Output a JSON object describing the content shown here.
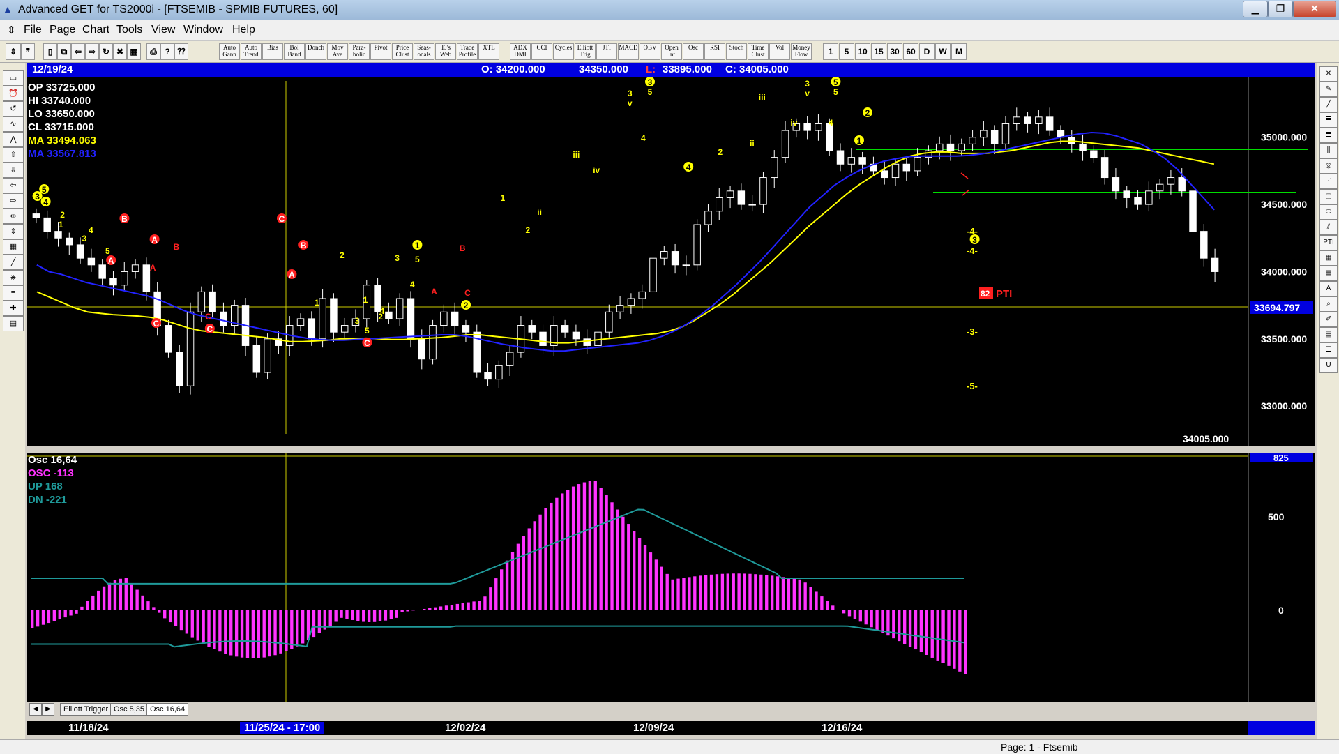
{
  "window": {
    "title": "Advanced GET for TS2000i - [FTSEMIB - SPMIB FUTURES, 60]",
    "buttons": {
      "minimize": "▁",
      "maximize": "❐",
      "close": "✕"
    }
  },
  "menu": [
    "File",
    "Page",
    "Chart",
    "Tools",
    "View",
    "Window",
    "Help"
  ],
  "toolbar": {
    "studies": [
      "Auto Gann",
      "Auto Trend",
      "Bias",
      "Bol Band",
      "Donch",
      "Mov Ave",
      "Para-bolic",
      "Pivot",
      "Price Clust",
      "Seas-onals",
      "TJ's Web",
      "Trade Profile",
      "XTL",
      "ADX DMI",
      "CCI",
      "Cycles",
      "Elliott Trig",
      "JTI",
      "MACD",
      "OBV",
      "Open Int",
      "Osc",
      "RSI",
      "Stoch",
      "Time Clust",
      "Vol",
      "Money Flow"
    ],
    "intervals": [
      "1",
      "5",
      "10",
      "15",
      "30",
      "60",
      "D",
      "W",
      "M"
    ]
  },
  "infobar": {
    "date": "12/19/24",
    "open": "O: 34200.000",
    "high": "34350.000",
    "low_label": "L:",
    "low_value": "33895.000",
    "close": "C: 34005.000"
  },
  "legend": {
    "op": "OP  33725.000",
    "hi": "HI   33740.000",
    "lo": "LO  33650.000",
    "cl": "CL  33715.000",
    "ma1": "MA 33494.063",
    "ma2": "MA 33567.813"
  },
  "price_axis": {
    "labels": [
      "35000.000",
      "34500.000",
      "34000.000",
      "33500.000",
      "33000.000"
    ],
    "current": "33694.797",
    "last": "34005.000"
  },
  "pti": {
    "value": "82",
    "label": "PTI"
  },
  "proj_labels": [
    "-4-",
    "-4-",
    "-3-",
    "-5-"
  ],
  "osc_legend": {
    "title": "Osc 16,64",
    "osc": "OSC -113",
    "up": "UP   168",
    "dn": "DN   -221"
  },
  "osc_axis": {
    "top": "825",
    "labels": [
      "500",
      "0"
    ]
  },
  "tabs": [
    "Elliott Trigger",
    "Osc 5,35",
    "Osc 16,64"
  ],
  "dates": {
    "labels": [
      "11/18/24",
      "12/02/24",
      "12/09/24",
      "12/16/24"
    ],
    "cursor": "11/25/24 - 17:00"
  },
  "status": "Page: 1 - Ftsemib",
  "colors": {
    "bg": "#000000",
    "candles": "#ffffff",
    "ma_yellow": "#ffff00",
    "ma_blue": "#2222ff",
    "osc_bar": "#ff33ff",
    "band": "#1f9a9a",
    "target": "#00dd00",
    "wave_red": "#ff2020",
    "info_blue": "#0000e0"
  },
  "chart_data": {
    "type": "candlestick",
    "ylim": [
      32700,
      35450
    ],
    "close": [
      34400,
      34300,
      34250,
      34200,
      34100,
      34050,
      33950,
      33900,
      34000,
      34050,
      33850,
      33600,
      33400,
      33150,
      33700,
      33850,
      33700,
      33600,
      33750,
      33450,
      33250,
      33500,
      33450,
      33600,
      33650,
      33500,
      33800,
      33550,
      33600,
      33650,
      33900,
      33700,
      33650,
      33800,
      33500,
      33350,
      33600,
      33700,
      33600,
      33550,
      33250,
      33200,
      33300,
      33400,
      33600,
      33550,
      33450,
      33600,
      33550,
      33500,
      33450,
      33550,
      33700,
      33750,
      33800,
      33850,
      34100,
      34150,
      34050,
      34050,
      34350,
      34450,
      34550,
      34600,
      34500,
      34500,
      34700,
      34850,
      35050,
      35100,
      35050,
      35100,
      34900,
      34800,
      34850,
      34800,
      34750,
      34700,
      34800,
      34750,
      34850,
      34900,
      34950,
      34900,
      34950,
      35000,
      35050,
      34950,
      35100,
      35150,
      35100,
      35150,
      35050,
      35000,
      34950,
      34900,
      34850,
      34700,
      34600,
      34550,
      34500,
      34600,
      34650,
      34700,
      34600,
      34300,
      34100,
      34000
    ],
    "ma_yellow": [
      33850,
      33810,
      33770,
      33730,
      33700,
      33690,
      33680,
      33675,
      33670,
      33660,
      33640,
      33610,
      33580,
      33560,
      33550,
      33540,
      33530,
      33520,
      33510,
      33495,
      33480,
      33480,
      33485,
      33490,
      33500,
      33500,
      33505,
      33500,
      33495,
      33495,
      33500,
      33505,
      33510,
      33520,
      33530,
      33530,
      33520,
      33510,
      33500,
      33490,
      33480,
      33470,
      33470,
      33480,
      33490,
      33500,
      33510,
      33520,
      33530,
      33540,
      33560,
      33590,
      33640,
      33700,
      33760,
      33830,
      33910,
      33990,
      34070,
      34160,
      34250,
      34340,
      34420,
      34500,
      34580,
      34650,
      34710,
      34770,
      34820,
      34860,
      34880,
      34890,
      34890,
      34880,
      34880,
      34880,
      34890,
      34900,
      34920,
      34940,
      34960,
      34970,
      34970,
      34960,
      34950,
      34940,
      34930,
      34920,
      34900,
      34880,
      34860,
      34840,
      34820,
      34800
    ],
    "ma_blue": [
      34050,
      34000,
      33980,
      33950,
      33920,
      33900,
      33880,
      33860,
      33840,
      33820,
      33790,
      33750,
      33710,
      33680,
      33660,
      33640,
      33620,
      33600,
      33580,
      33560,
      33540,
      33520,
      33505,
      33495,
      33490,
      33490,
      33495,
      33500,
      33505,
      33510,
      33515,
      33520,
      33525,
      33530,
      33530,
      33520,
      33500,
      33480,
      33460,
      33445,
      33430,
      33420,
      33410,
      33410,
      33420,
      33430,
      33440,
      33450,
      33460,
      33470,
      33490,
      33520,
      33560,
      33610,
      33670,
      33740,
      33820,
      33900,
      33990,
      34080,
      34180,
      34280,
      34380,
      34480,
      34560,
      34640,
      34700,
      34750,
      34790,
      34820,
      34840,
      34855,
      34860,
      34860,
      34860,
      34860,
      34865,
      34875,
      34890,
      34910,
      34930,
      34950,
      34970,
      34990,
      35010,
      35025,
      35035,
      35030,
      35010,
      34980,
      34950,
      34900,
      34840,
      34760,
      34660,
      34560,
      34460
    ]
  }
}
